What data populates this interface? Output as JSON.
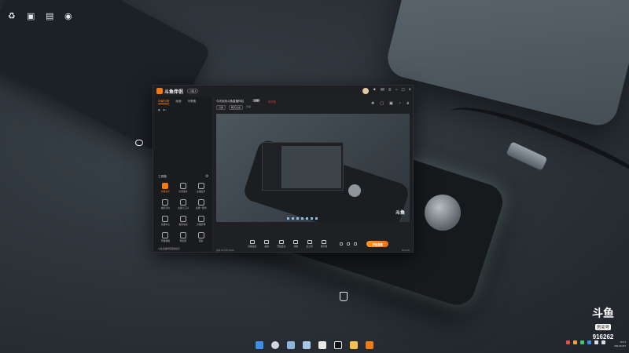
{
  "desktop_icons": [
    {
      "name": "recycle-bin-icon",
      "label": "♻"
    },
    {
      "name": "folder-icon",
      "label": "▣"
    },
    {
      "name": "computer-icon",
      "label": "▤"
    },
    {
      "name": "settings-icon",
      "label": "◉"
    }
  ],
  "app": {
    "logo_text": "斗鱼伴侣",
    "version_badge": "斗鱼 ▾",
    "sidebar": {
      "tabs": [
        "场景切换",
        "画面",
        "可教备"
      ],
      "tools_title": "工具箱",
      "tools": [
        {
          "label": "弹幕助手",
          "highlight": true
        },
        {
          "label": "房管助手",
          "highlight": false
        },
        {
          "label": "主播任务",
          "highlight": false
        },
        {
          "label": "抽奖活动",
          "highlight": false
        },
        {
          "label": "主播小工具",
          "highlight": false
        },
        {
          "label": "主播一级榜",
          "highlight": false
        },
        {
          "label": "直播中心",
          "highlight": false
        },
        {
          "label": "发布动态",
          "highlight": false
        },
        {
          "label": "直播管理",
          "highlight": false
        },
        {
          "label": "开播教程",
          "highlight": false
        },
        {
          "label": "粉丝团",
          "highlight": false
        },
        {
          "label": "更多",
          "highlight": false
        }
      ],
      "footer": "斗鱼直播伴侣更新提示"
    },
    "main": {
      "room_title": "今天玩玩斗鱼直播伴侣",
      "room_badge": "主播",
      "room_status": "未开播",
      "meta_category": "分类",
      "meta_tag": "聊天交友",
      "meta_extra": "分享"
    },
    "controls": [
      "直播设置",
      "美颜",
      "开启连麦",
      "弹幕",
      "麦克风",
      "扬声器"
    ],
    "live_button": "开始直播",
    "status_left": "帧率 60 码率 2500K",
    "status_right": "00:00:00"
  },
  "watermark": {
    "brand": "斗鱼",
    "room_label": "房间号",
    "room_number": "916262"
  },
  "clock": {
    "time": "15:21",
    "date": "2021/11/27"
  }
}
